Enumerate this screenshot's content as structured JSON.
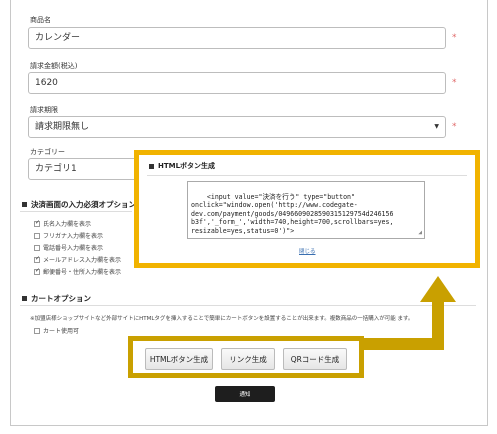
{
  "form": {
    "product_name_label": "商品名",
    "product_name_value": "カレンダー",
    "amount_label": "請求金額(税込)",
    "amount_value": "1620",
    "deadline_label": "請求期限",
    "deadline_value": "請求期限無し",
    "category_label": "カテゴリー",
    "category_value": "カテゴリ1",
    "required_mark": "*"
  },
  "payment_screen": {
    "heading": "決済画面の入力必須オプション",
    "items": [
      {
        "label": "氏名入力欄を表示",
        "checked": true
      },
      {
        "label": "フリガナ入力欄を表示",
        "checked": false
      },
      {
        "label": "電話番号入力欄を表示",
        "checked": false
      },
      {
        "label": "メールアドレス入力欄を表示",
        "checked": true
      },
      {
        "label": "郵便番号・住所入力欄を表示",
        "checked": true
      }
    ]
  },
  "cart_option": {
    "heading": "カートオプション",
    "note": "※加盟店様ショップサイトなど外部サイトにHTMLタグを挿入することで簡単にカートボタンを設置することが出来ます。複数商品の一括購入が可能 ます。",
    "use_label": "カート使用可"
  },
  "popup": {
    "title": "HTMLボタン生成",
    "code": "<input value=\"決済を行う\" type=\"button\"\nonclick=\"window.open('http://www.codegate-\ndev.com/payment/goods/0496609028590315129754d246156\nb3f','_form_','width=740,height=700,scrollbars=yes,\nresizable=yes,status=0')\">",
    "close_label": "閉じる"
  },
  "buttons": {
    "html_button": "HTMLボタン生成",
    "link_button": "リンク生成",
    "qr_button": "QRコード生成",
    "update_button": "通知"
  },
  "colors": {
    "highlight_yellow": "#f1b300",
    "highlight_dark_yellow": "#c9a000",
    "arrow_color": "#c9a000"
  }
}
